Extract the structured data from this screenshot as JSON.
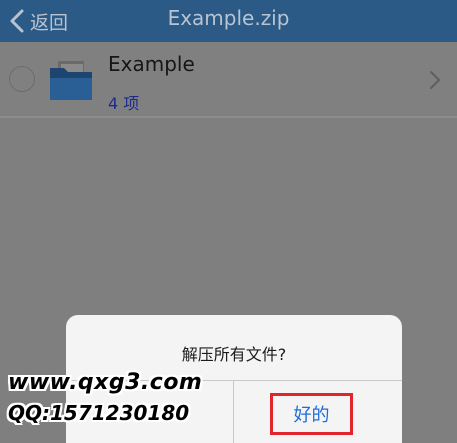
{
  "navbar": {
    "back_label": "返回",
    "title": "Example.zip"
  },
  "list": {
    "items": [
      {
        "title": "Example",
        "subtitle": "4 项",
        "icon": "folder-icon"
      }
    ]
  },
  "alert": {
    "message": "解压所有文件?",
    "ok_label": "好的"
  },
  "watermark": {
    "line1": "www.qxg3.com",
    "line2": "QQ:1571230180"
  },
  "colors": {
    "navbar_bg": "#2c5a86",
    "dim_overlay": "#7f7f7f",
    "ok_text": "#1f6cd8",
    "highlight_border": "#e0262a",
    "subtitle_text": "#1c2a8a"
  }
}
